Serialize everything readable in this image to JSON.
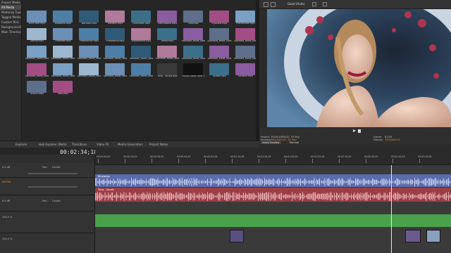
{
  "tree": {
    "items": [
      "Project Media",
      "All Media",
      "Media by Type",
      "Tagged Media",
      "Custom Bins",
      "Background Bins",
      "Main Timeline"
    ]
  },
  "pool": {
    "files": [
      "s0rcc1om.mp4",
      "autoanna.mp4",
      "Warnock.mp4",
      "Barbara.mp4",
      "charcodes.mp4",
      "ElectroBand.mp4",
      "flow.mp4",
      "cryotank.mp4",
      "monomode.mp4",
      "Vanilla.mp4",
      "ProBeast.mp4",
      "ProBaseline.mp4",
      "ProBasePro.mp4",
      "programmer.mp4",
      "Gener.mp4",
      "Standard_Mode_sees",
      "Standard_Mode_vivid",
      "Standard_Mode_sees",
      "Standard_Mode_sees",
      "Standard_Mode_sees",
      "Standard_Mode_sees",
      "Standard_Mode_sees",
      "Standard_Mode_sees",
      "Standard_Mode_sees",
      "Standard_Mode_sees",
      "Standard_Mode_sees",
      "Standard_Mode_sees",
      "Standard_Mode_sees",
      "Standard_Mode_sees",
      "Standard_Mode_sees",
      "Standard_Mode_sees",
      "Standard_Mode_sees",
      "Tong - Vocals.wav",
      "VEGAS Solid Color 1",
      "asdfas.mp4",
      "soulbird.mp4",
      "Unlock.mp4",
      "zero.mp4"
    ]
  },
  "preview": {
    "quality": "Good (Auto)",
    "project_label": "Project:",
    "project_value": "1920x1080x32, 59.94p",
    "preview_label": "Preview:",
    "preview_value": "960x540x32, 59.94p",
    "frame_label": "Frame:",
    "frame_value": "6,016",
    "display_label": "Display:",
    "display_value": "320x180x32",
    "tabs": [
      "Video Preview",
      "Trimmer"
    ]
  },
  "bottom_tabs": [
    "Explorer",
    "Hub Explorer (Beta)",
    "Transitions",
    "Video FX",
    "Media Generators",
    "Project Notes"
  ],
  "timeline": {
    "timecode": "00:02:34;18",
    "ruler_ticks": [
      "00:00:00;00",
      "00:00:14;29",
      "00:00:29;29",
      "00:00:44;29",
      "00:00:59;28",
      "00:01:14;28",
      "00:01:29;29",
      "00:01:44;29",
      "00:01:59;28",
      "00:02:14;29",
      "00:02:29;29",
      "00:02:44;29",
      "00:02:59;28"
    ],
    "track_labels": {
      "level_top": "0.0 dB",
      "pan1": "Pan:",
      "pan1_val": "Center",
      "muted": "MUTED",
      "level2": "0.0 dB",
      "pan2": "Pan:",
      "pan2_val": "Center",
      "vol3": "100.0 %",
      "vol4": "100.0 %"
    },
    "clips": {
      "audio1": "Bluegrass",
      "audio2": "Tong - Vocals"
    }
  },
  "colors": {
    "audio_track": "#5a6cab",
    "vocal_track": "#9b3e46",
    "video_track": "#4ba04b",
    "accent": "#e08c2c"
  }
}
